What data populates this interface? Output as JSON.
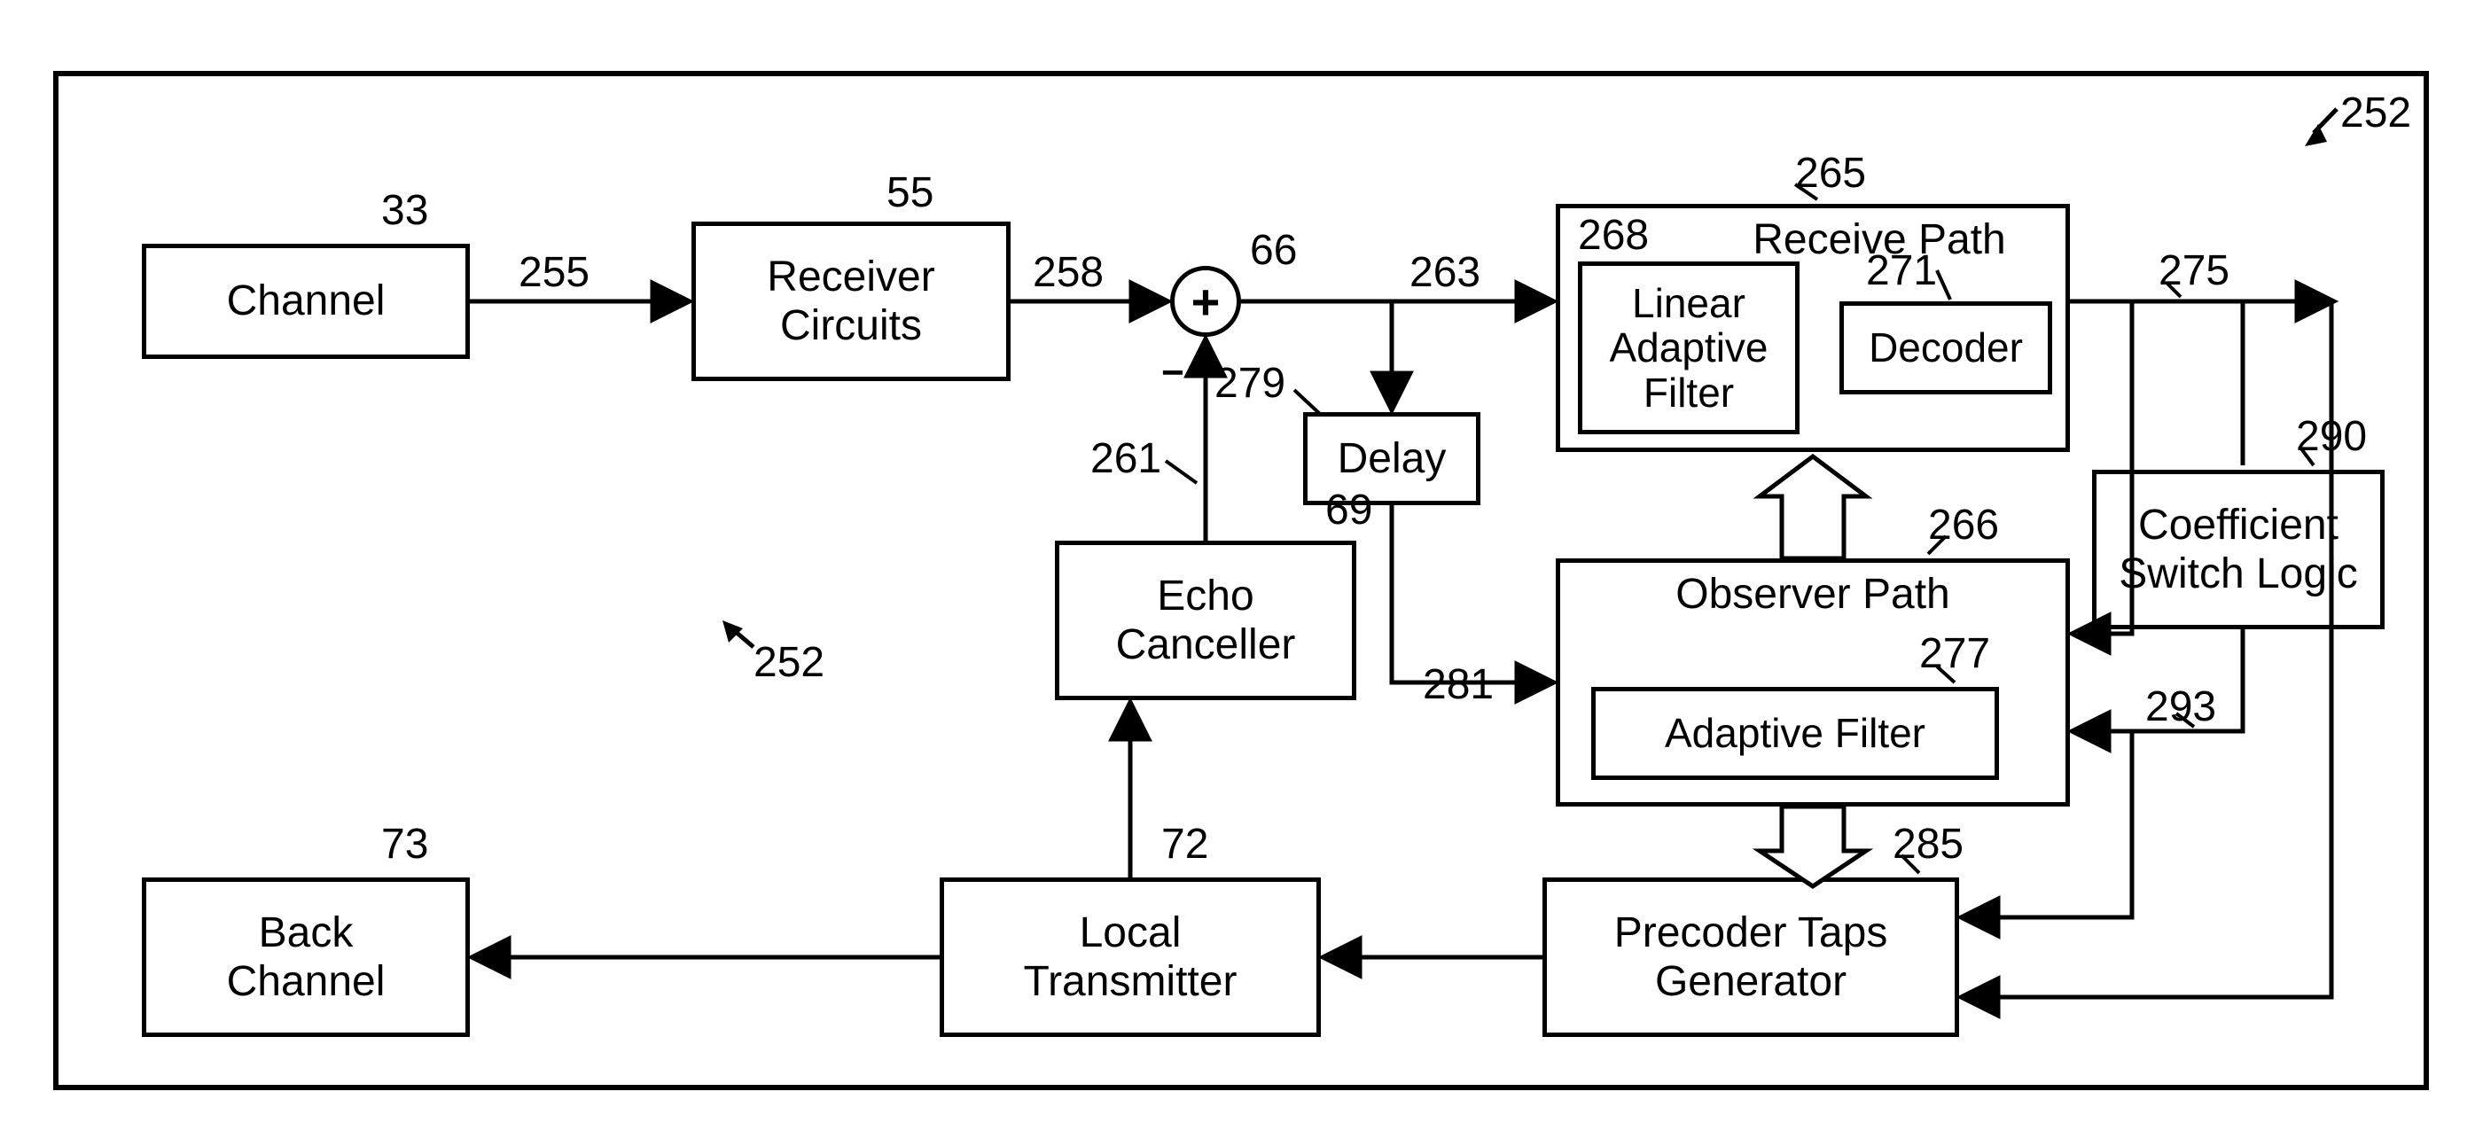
{
  "blocks": {
    "channel": "Channel",
    "receiver": "Receiver\nCircuits",
    "echo": "Echo\nCanceller",
    "delay": "Delay",
    "back_channel": "Back\nChannel",
    "local_tx": "Local\nTransmitter",
    "precoder": "Precoder Taps\nGenerator",
    "coeff_switch": "Coefficient\nSwitch Logic",
    "linear_filter": "Linear\nAdaptive\nFilter",
    "decoder": "Decoder",
    "adaptive_filter": "Adaptive Filter"
  },
  "path_labels": {
    "receive": "Receive Path",
    "observer": "Observer Path"
  },
  "ref_labels": {
    "channel_n": "33",
    "receiver_n": "55",
    "summer_n": "66",
    "echo_n": "69",
    "local_tx_n": "72",
    "back_channel_n": "73",
    "system_n": "252",
    "inner_system_n": "252",
    "sig_255": "255",
    "sig_258": "258",
    "sig_261": "261",
    "sig_263": "263",
    "receive_path_n": "265",
    "observer_path_n": "266",
    "linear_filter_n": "268",
    "decoder_n": "271",
    "sig_275": "275",
    "adaptive_filter_n": "277",
    "delay_n": "279",
    "sig_281": "281",
    "precoder_n": "285",
    "coeff_n": "290",
    "sig_293": "293"
  },
  "signs": {
    "plus": "+",
    "minus": "−"
  }
}
